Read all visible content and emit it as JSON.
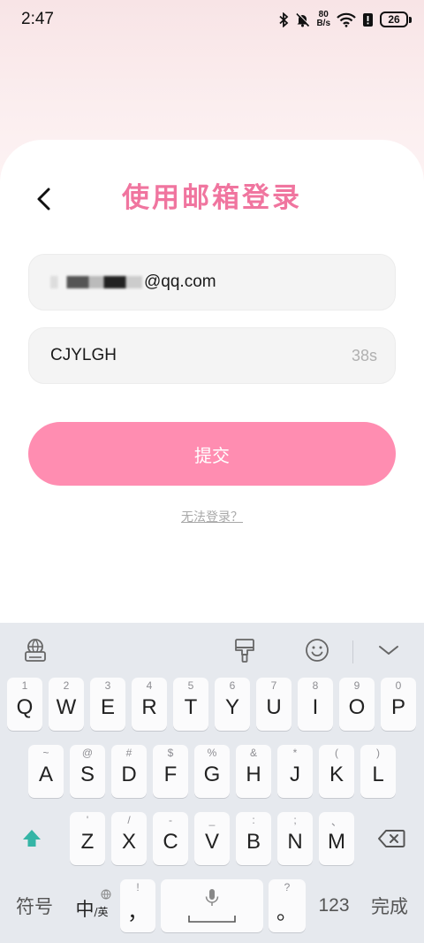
{
  "status": {
    "time": "2:47",
    "net_speed_value": "80",
    "net_speed_unit": "B/s",
    "battery": "26"
  },
  "page": {
    "title": "使用邮箱登录",
    "email_value": "@qq.com",
    "code_value": "CJYLGH",
    "countdown": "38s",
    "submit_label": "提交",
    "cant_login_label": "无法登录？"
  },
  "keyboard": {
    "row1": [
      {
        "key": "Q",
        "sub": "1"
      },
      {
        "key": "W",
        "sub": "2"
      },
      {
        "key": "E",
        "sub": "3"
      },
      {
        "key": "R",
        "sub": "4"
      },
      {
        "key": "T",
        "sub": "5"
      },
      {
        "key": "Y",
        "sub": "6"
      },
      {
        "key": "U",
        "sub": "7"
      },
      {
        "key": "I",
        "sub": "8"
      },
      {
        "key": "O",
        "sub": "9"
      },
      {
        "key": "P",
        "sub": "0"
      }
    ],
    "row2": [
      {
        "key": "A",
        "sub": "~"
      },
      {
        "key": "S",
        "sub": "@"
      },
      {
        "key": "D",
        "sub": "#"
      },
      {
        "key": "F",
        "sub": "$"
      },
      {
        "key": "G",
        "sub": "%"
      },
      {
        "key": "H",
        "sub": "&"
      },
      {
        "key": "J",
        "sub": "*"
      },
      {
        "key": "K",
        "sub": "("
      },
      {
        "key": "L",
        "sub": ")"
      }
    ],
    "row3": [
      {
        "key": "Z",
        "sub": "'"
      },
      {
        "key": "X",
        "sub": "/"
      },
      {
        "key": "C",
        "sub": "-"
      },
      {
        "key": "V",
        "sub": "_"
      },
      {
        "key": "B",
        "sub": ":"
      },
      {
        "key": "N",
        "sub": ";"
      },
      {
        "key": "M",
        "sub": "、"
      }
    ],
    "symbols_label": "符号",
    "lang_main": "中",
    "lang_sub": "/英",
    "comma_key": "，",
    "comma_sub": "!",
    "period_key": "。",
    "period_sub": "?",
    "num_label": "123",
    "done_label": "完成"
  },
  "colors": {
    "accent": "#f0759f",
    "button": "#ff8db1",
    "shift": "#35b5a6"
  }
}
